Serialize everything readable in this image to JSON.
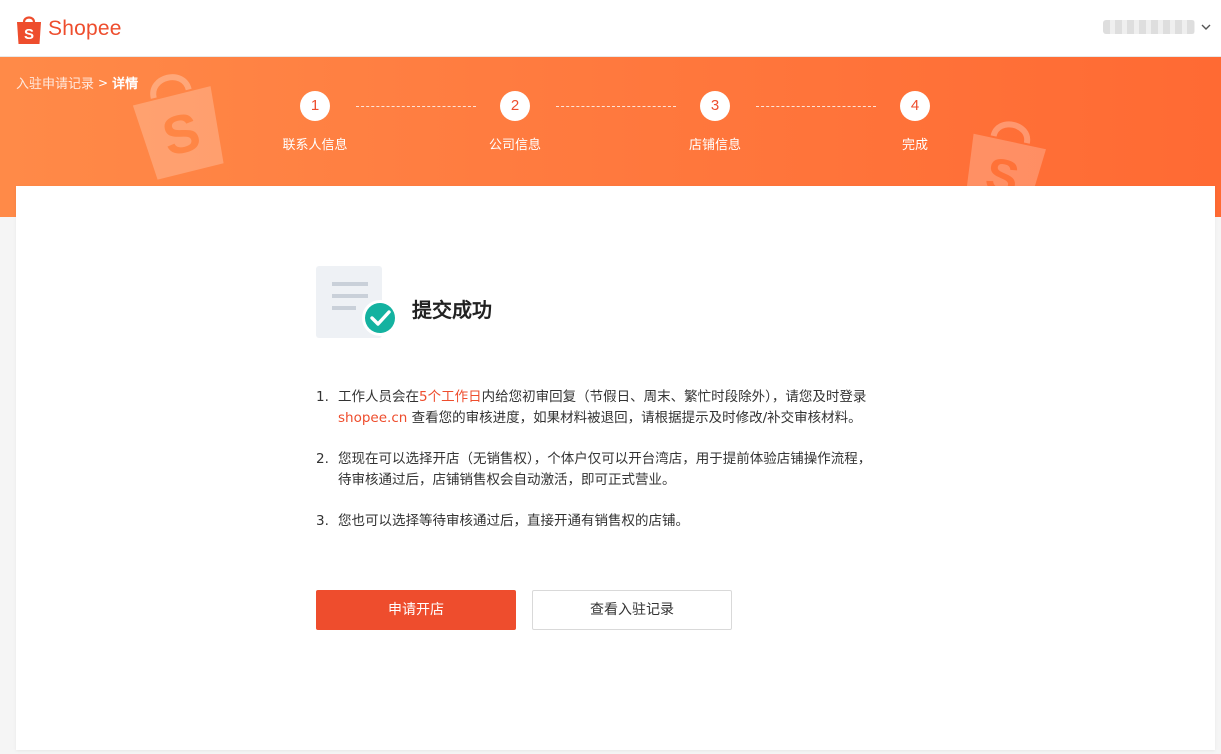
{
  "header": {
    "logo_text": "Shopee",
    "logo_letter": "S"
  },
  "breadcrumb": {
    "parent": "入驻申请记录",
    "separator": ">",
    "current": "详情"
  },
  "steps": [
    {
      "number": "1",
      "label": "联系人信息"
    },
    {
      "number": "2",
      "label": "公司信息"
    },
    {
      "number": "3",
      "label": "店铺信息"
    },
    {
      "number": "4",
      "label": "完成"
    }
  ],
  "result": {
    "title": "提交成功"
  },
  "notes": [
    {
      "index": "1.",
      "text_before": "工作人员会在",
      "highlight": "5个工作日",
      "text_middle": "内给您初审回复（节假日、周末、繁忙时段除外），请您及时登录",
      "link": "shopee.cn",
      "text_after": " 查看您的审核进度，如果材料被退回，请根据提示及时修改/补交审核材料。"
    },
    {
      "index": "2.",
      "line1": "您现在可以选择开店（无销售权），个体户仅可以开台湾店，用于提前体验店铺操作流程，",
      "line2": "待审核通过后，店铺销售权会自动激活，即可正式营业。"
    },
    {
      "index": "3.",
      "text": "您也可以选择等待审核通过后，直接开通有销售权的店铺。"
    }
  ],
  "buttons": {
    "primary": "申请开店",
    "secondary": "查看入驻记录"
  },
  "colors": {
    "brand": "#ee4d2d",
    "banner": "#ff7c40",
    "success": "#14b2a0"
  }
}
